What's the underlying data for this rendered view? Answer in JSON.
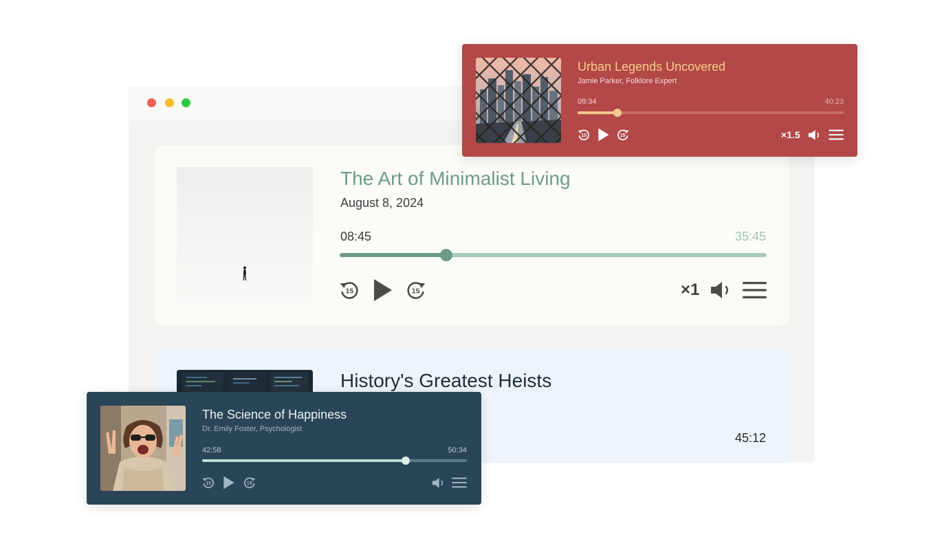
{
  "window": {
    "traffic_lights": {
      "close": "#ee5f56",
      "minimize": "#f6bd30",
      "maximize": "#2fc840"
    }
  },
  "main_player": {
    "title": "The Art of Minimalist Living",
    "date": "August 8, 2024",
    "current_time": "08:45",
    "total_time": "35:45",
    "progress": 0.25,
    "speed": "×1",
    "accent_color": "#6e9b88",
    "icons": [
      "rewind-15-icon",
      "play-icon",
      "forward-15-icon",
      "volume-icon",
      "menu-icon"
    ]
  },
  "second_card": {
    "title": "History's Greatest Heists",
    "duration": "45:12"
  },
  "red_player": {
    "title": "Urban Legends Uncovered",
    "subtitle": "Jamie Parker, Folklore Expert",
    "current_time": "09:34",
    "total_time": "40:23",
    "progress": 0.15,
    "speed": "×1.5",
    "background_color": "#b34848",
    "accent_color": "#f2c98e"
  },
  "navy_player": {
    "title": "The Science of Happiness",
    "subtitle": "Dr. Emily Foster, Psychologist",
    "current_time": "42:58",
    "total_time": "50:34",
    "progress": 0.77,
    "background_color": "#2b4558",
    "accent_color": "#b8e0cf"
  }
}
